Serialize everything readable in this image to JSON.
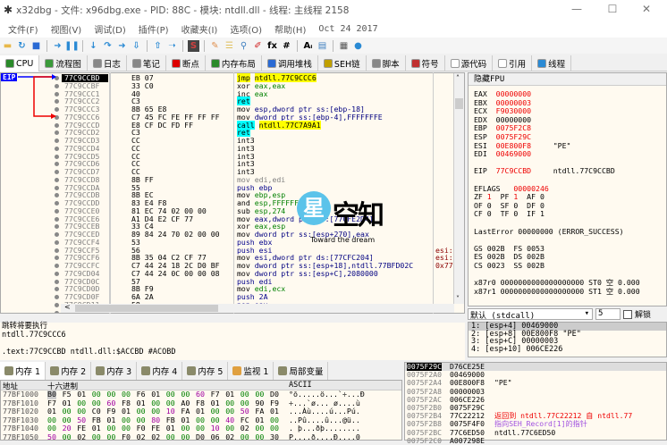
{
  "title": "x32dbg - 文件: x96dbg.exe - PID: 88C - 模块: ntdll.dll - 线程: 主线程 2158",
  "menu": [
    "文件(F)",
    "视图(V)",
    "调试(D)",
    "插件(P)",
    "收藏夹(I)",
    "选项(O)",
    "帮助(H)",
    "Oct 24 2017"
  ],
  "toolbar": [
    {
      "icon": "open-icon",
      "c": "#e8b84a"
    },
    {
      "icon": "restart-icon",
      "c": "#2a8ad4"
    },
    {
      "icon": "stop-icon",
      "c": "#2a6ad4"
    },
    {
      "icon": "run-icon",
      "c": "#2a8ad4"
    },
    {
      "icon": "pause-icon",
      "c": "#2a8ad4"
    },
    {
      "icon": "step-into-icon",
      "c": "#2a8ad4"
    },
    {
      "icon": "step-over-icon",
      "c": "#2a8ad4"
    },
    {
      "icon": "trace-into-icon",
      "c": "#2a8ad4"
    },
    {
      "icon": "trace-over-icon",
      "c": "#2a8ad4"
    },
    {
      "icon": "execute-till-return-icon",
      "c": "#2a8ad4"
    },
    {
      "icon": "run-to-user-code-icon",
      "c": "#2a8ad4"
    },
    {
      "icon": "scylla-icon",
      "c": "#b03030"
    },
    {
      "icon": "patch-icon",
      "c": "#e09050"
    },
    {
      "icon": "comment-icon",
      "c": "#e0c060"
    },
    {
      "icon": "label-icon",
      "c": "#4080c0"
    },
    {
      "icon": "bookmark-icon",
      "c": "#d02020"
    },
    {
      "icon": "function-icon",
      "c": "#000"
    },
    {
      "icon": "hash-icon",
      "c": "#000"
    },
    {
      "icon": "font-icon",
      "c": "#000"
    },
    {
      "icon": "module-icon",
      "c": "#4080c0"
    },
    {
      "icon": "calculator-icon",
      "c": "#555"
    },
    {
      "icon": "globe-icon",
      "c": "#2a8ad4"
    }
  ],
  "tabs": [
    {
      "label": "CPU",
      "c": "#2a8a2a"
    },
    {
      "label": "流程图",
      "c": "#3a9a3a"
    },
    {
      "label": "日志",
      "c": "#888"
    },
    {
      "label": "笔记",
      "c": "#888"
    },
    {
      "label": "断点",
      "c": "#d00"
    },
    {
      "label": "内存布局",
      "c": "#2a8a2a"
    },
    {
      "label": "调用堆栈",
      "c": "#2a6ad4"
    },
    {
      "label": "SEH链",
      "c": "#c0a000"
    },
    {
      "label": "脚本",
      "c": "#888"
    },
    {
      "label": "符号",
      "c": "#c03030"
    },
    {
      "label": "源代码",
      "c": "#fff"
    },
    {
      "label": "引用",
      "c": "#fff"
    },
    {
      "label": "线程",
      "c": "#2a8ad4"
    }
  ],
  "eip_label": "EIP",
  "disasm": [
    [
      "77C9CCBD",
      "EB 07",
      "jmp",
      "ntdll.77C9CCC6",
      ""
    ],
    [
      "77C9CCBF",
      "33 C0",
      "xor",
      "eax,eax",
      ""
    ],
    [
      "77C9CCC1",
      "40",
      "inc",
      "eax",
      ""
    ],
    [
      "77C9CCC2",
      "C3",
      "ret",
      "",
      ""
    ],
    [
      "77C9CCC3",
      "8B 65 E8",
      "mov",
      "esp,dword ptr ss:[ebp-18]",
      ""
    ],
    [
      "77C9CCC6",
      "C7 45 FC FE FF FF FF",
      "mov",
      "dword ptr ss:[ebp-4],FFFFFFFE",
      ""
    ],
    [
      "77C9CCCD",
      "E8 CF DC FD FF",
      "call",
      "ntdll.77C7A9A1",
      ""
    ],
    [
      "77C9CCD2",
      "C3",
      "ret",
      "",
      ""
    ],
    [
      "77C9CCD3",
      "CC",
      "int3",
      "",
      ""
    ],
    [
      "77C9CCD4",
      "CC",
      "int3",
      "",
      ""
    ],
    [
      "77C9CCD5",
      "CC",
      "int3",
      "",
      ""
    ],
    [
      "77C9CCD6",
      "CC",
      "int3",
      "",
      ""
    ],
    [
      "77C9CCD7",
      "CC",
      "int3",
      "",
      ""
    ],
    [
      "77C9CCD8",
      "8B FF",
      "mov",
      "edi,edi",
      ""
    ],
    [
      "77C9CCDA",
      "55",
      "push",
      "ebp",
      ""
    ],
    [
      "77C9CCDB",
      "8B EC",
      "mov",
      "ebp,esp",
      ""
    ],
    [
      "77C9CCDD",
      "83 E4 F8",
      "and",
      "esp,FFFFFFF8",
      ""
    ],
    [
      "77C9CCE0",
      "81 EC 74 02 00 00",
      "sub",
      "esp,274",
      ""
    ],
    [
      "77C9CCE6",
      "A1 D4 E2 CF 77",
      "mov",
      "eax,dword ptr ds:[77CFE2D4]",
      ""
    ],
    [
      "77C9CCEB",
      "33 C4",
      "xor",
      "eax,esp",
      ""
    ],
    [
      "77C9CCED",
      "89 84 24 70 02 00 00",
      "mov",
      "dword ptr ss:[esp+270],eax",
      ""
    ],
    [
      "77C9CCF4",
      "53",
      "push",
      "ebx",
      ""
    ],
    [
      "77C9CCF5",
      "56",
      "push",
      "esi",
      "esi:"
    ],
    [
      "77C9CCF6",
      "8B 35 04 C2 CF 77",
      "mov",
      "esi,dword ptr ds:[77CFC204]",
      "esi:"
    ],
    [
      "77C9CCFC",
      "C7 44 24 18 2C D0 BF",
      "mov",
      "dword ptr ss:[esp+18],ntdll.77BFD02C",
      "0x77"
    ],
    [
      "77C9CD04",
      "C7 44 24 0C 00 00 08",
      "mov",
      "dword ptr ss:[esp+C],2080000",
      ""
    ],
    [
      "77C9CD0C",
      "57",
      "push",
      "edi",
      ""
    ],
    [
      "77C9CD0D",
      "8B F9",
      "mov",
      "edi,ecx",
      ""
    ],
    [
      "77C9CD0F",
      "6A 2A",
      "push",
      "2A",
      ""
    ],
    [
      "77C9CD11",
      "58",
      "pop",
      "eax",
      ""
    ],
    [
      "77C9CD12",
      "66 89 44 24 18",
      "mov",
      "word ptr ss:[esp+18],ax",
      ""
    ]
  ],
  "watermark": {
    "logo_char": "星",
    "name": "空知",
    "slogan": "Toward the dream"
  },
  "registers": {
    "header": "隐藏FPU",
    "lines": [
      [
        [
          "EAX  ",
          ""
        ],
        [
          "00000000",
          "red"
        ]
      ],
      [
        [
          "EBX  ",
          ""
        ],
        [
          "00000003",
          "red"
        ]
      ],
      [
        [
          "ECX  ",
          ""
        ],
        [
          "F9030000",
          "red"
        ]
      ],
      [
        [
          "EDX  ",
          ""
        ],
        [
          "00000000",
          ""
        ]
      ],
      [
        [
          "EBP  ",
          ""
        ],
        [
          "0075F2C8",
          "red"
        ]
      ],
      [
        [
          "ESP  ",
          ""
        ],
        [
          "0075F29C",
          "red"
        ]
      ],
      [
        [
          "ESI  ",
          ""
        ],
        [
          "00E800F8",
          "red"
        ],
        [
          "     \"PE\"",
          ""
        ]
      ],
      [
        [
          "EDI  ",
          ""
        ],
        [
          "00469000",
          "red"
        ]
      ],
      [
        [
          "",
          ""
        ]
      ],
      [
        [
          "EIP  ",
          ""
        ],
        [
          "77C9CCBD",
          "red"
        ],
        [
          "     ntdll.77C9CCBD",
          ""
        ]
      ],
      [
        [
          "",
          ""
        ]
      ],
      [
        [
          "EFLAGS   ",
          ""
        ],
        [
          "00000246",
          "red"
        ]
      ],
      [
        [
          "ZF ",
          ""
        ],
        [
          "1",
          "red"
        ],
        [
          "  PF ",
          ""
        ],
        [
          "1",
          "red"
        ],
        [
          "  AF 0",
          ""
        ]
      ],
      [
        [
          "OF 0  SF 0  DF 0",
          ""
        ]
      ],
      [
        [
          "CF 0  TF 0  IF 1",
          ""
        ]
      ],
      [
        [
          "",
          ""
        ]
      ],
      [
        [
          "LastError 00000000 (ERROR_SUCCESS)",
          ""
        ]
      ],
      [
        [
          "",
          ""
        ]
      ],
      [
        [
          "GS 002B  FS 0053",
          ""
        ]
      ],
      [
        [
          "ES 002B  DS 002B",
          ""
        ]
      ],
      [
        [
          "CS 0023  SS 002B",
          ""
        ]
      ],
      [
        [
          "",
          ""
        ]
      ],
      [
        [
          "x87r0 0000000000000000000 ST0 空 0.000",
          ""
        ]
      ],
      [
        [
          "x87r1 0000000000000000000 ST1 空 0.000",
          ""
        ]
      ]
    ]
  },
  "callconv": {
    "selected": "默认 (stdcall)",
    "count": "5",
    "unlock_label": "解锁"
  },
  "args": [
    "1: [esp+4] 00469000",
    "2: [esp+8] 00E800F8 \"PE\"",
    "3: [esp+C] 00000003",
    "4: [esp+10] 006CE226"
  ],
  "info": [
    "跳转将要执行",
    "ntdll.77C9CCC6",
    "",
    ".text:77C9CCBD ntdll.dll:$ACCBD #ACOBD"
  ],
  "bottom_tabs": [
    {
      "label": "内存 1",
      "icon": "memory-icon"
    },
    {
      "label": "内存 2",
      "icon": "memory-icon"
    },
    {
      "label": "内存 3",
      "icon": "memory-icon"
    },
    {
      "label": "内存 4",
      "icon": "memory-icon"
    },
    {
      "label": "内存 5",
      "icon": "memory-icon"
    },
    {
      "label": "监视 1",
      "icon": "watch-icon"
    },
    {
      "label": "局部变量",
      "icon": "locals-icon"
    }
  ],
  "dump": {
    "headers": {
      "addr": "地址",
      "hex": "十六进制",
      "ascii": "ASCII"
    },
    "rows": [
      [
        "77BF1000",
        "B0 F5 01 00 00 00 F6 01 00 00 60 F7 01 00 00 D0",
        "°õ.....ö...`÷...Ð"
      ],
      [
        "77BF1010",
        "F7 01 00 00 60 F8 01 00 00 A0 F8 01 00 00 90 F9",
        "÷...`ø... ø....ù"
      ],
      [
        "77BF1020",
        "01 00 00 C0 F9 01 00 00 10 FA 01 00 00 50 FA 01",
        "...Àù....ú...Pú."
      ],
      [
        "77BF1030",
        "00 00 50 FB 01 00 00 80 FB 01 00 00 40 FC 01 00",
        "..Pû....û...@ü.."
      ],
      [
        "77BF1040",
        "00 20 FE 01 00 00 F0 FE 01 00 00 10 00 02 00 00",
        ". þ...ðþ........"
      ],
      [
        "77BF1050",
        "50 00 02 00 00 F0 02 02 00 00 D0 06 02 00 00 30",
        "P....ð....Ð....0"
      ]
    ]
  },
  "stack": [
    [
      "0075F29C",
      "D76CE25E",
      "",
      ""
    ],
    [
      "0075F2A0",
      "00469000",
      "",
      ""
    ],
    [
      "0075F2A4",
      "00E800F8",
      "\"PE\"",
      ""
    ],
    [
      "0075F2A8",
      "00000003",
      "",
      ""
    ],
    [
      "0075F2AC",
      "006CE226",
      "",
      ""
    ],
    [
      "0075F2B0",
      "0075F29C",
      "",
      ""
    ],
    [
      "0075F2B4",
      "77C22212",
      "返回到 ntdll.77C22212 自 ntdll.77",
      "#e00"
    ],
    [
      "0075F2B8",
      "0075F4F0",
      "指向SEH_Record[1]的指针",
      "#a050e0"
    ],
    [
      "0075F2BC",
      "77C6ED50",
      "ntdll.77C6ED50",
      ""
    ],
    [
      "0075F2C0",
      "A007298E",
      "",
      ""
    ]
  ]
}
